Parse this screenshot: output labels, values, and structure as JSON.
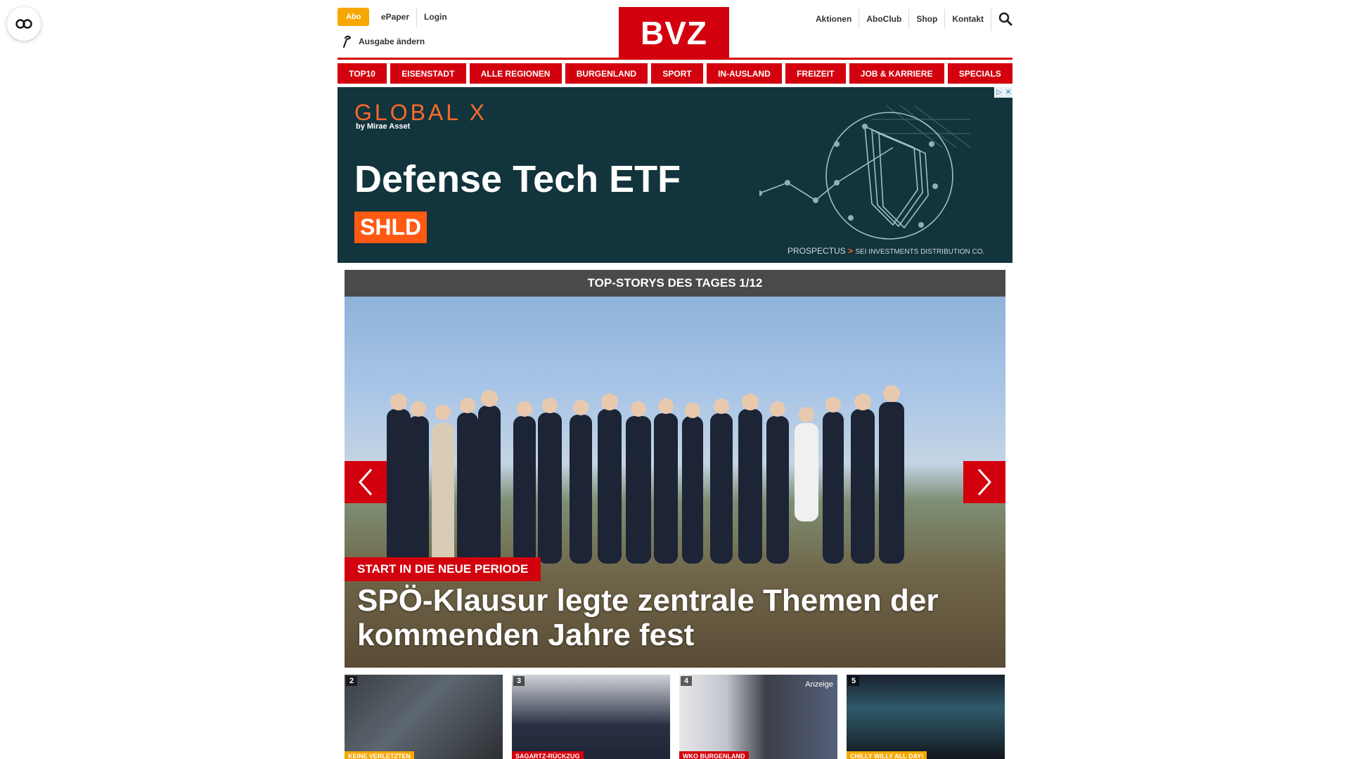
{
  "header": {
    "abo_label": "Abo",
    "epaper_label": "ePaper",
    "login_label": "Login",
    "edition_label": "Ausgabe ändern",
    "logo_text": "BVZ",
    "right_links": [
      "Aktionen",
      "AboClub",
      "Shop",
      "Kontakt"
    ]
  },
  "nav": [
    "TOP10",
    "EISENSTADT",
    "ALLE REGIONEN",
    "BURGENLAND",
    "SPORT",
    "IN-AUSLAND",
    "FREIZEIT",
    "JOB & KARRIERE",
    "SPECIALS"
  ],
  "ad": {
    "brand": "GLOBAL X",
    "sub": "by Mirae Asset",
    "headline": "Defense Tech ETF",
    "ticker": "SHLD",
    "footer_link": "PROSPECTUS",
    "footer_arrow": ">",
    "footer_note": "SEI INVESTMENTS DISTRIBUTION CO."
  },
  "stories": {
    "heading": "TOP-STORYS DES TAGES 1/12",
    "hero": {
      "kicker": "START IN DIE NEUE PERIODE",
      "title": "SPÖ-Klausur legte zentrale Themen der kommenden Jahre fest"
    },
    "thumbs": [
      {
        "num": "2",
        "tag": "KEINE VERLETZTEN"
      },
      {
        "num": "3",
        "tag": "SAGARTZ-RÜCKZUG"
      },
      {
        "num": "4",
        "tag": "WKO BURGENLAND",
        "ad": "Anzeige"
      },
      {
        "num": "5",
        "tag": "CHILLY WILLY ALL DAY!"
      }
    ]
  },
  "colors": {
    "brand_red": "#d3000d",
    "abo_yellow": "#f7a800",
    "ad_bg": "#12343c",
    "ad_orange": "#ff5a14"
  }
}
